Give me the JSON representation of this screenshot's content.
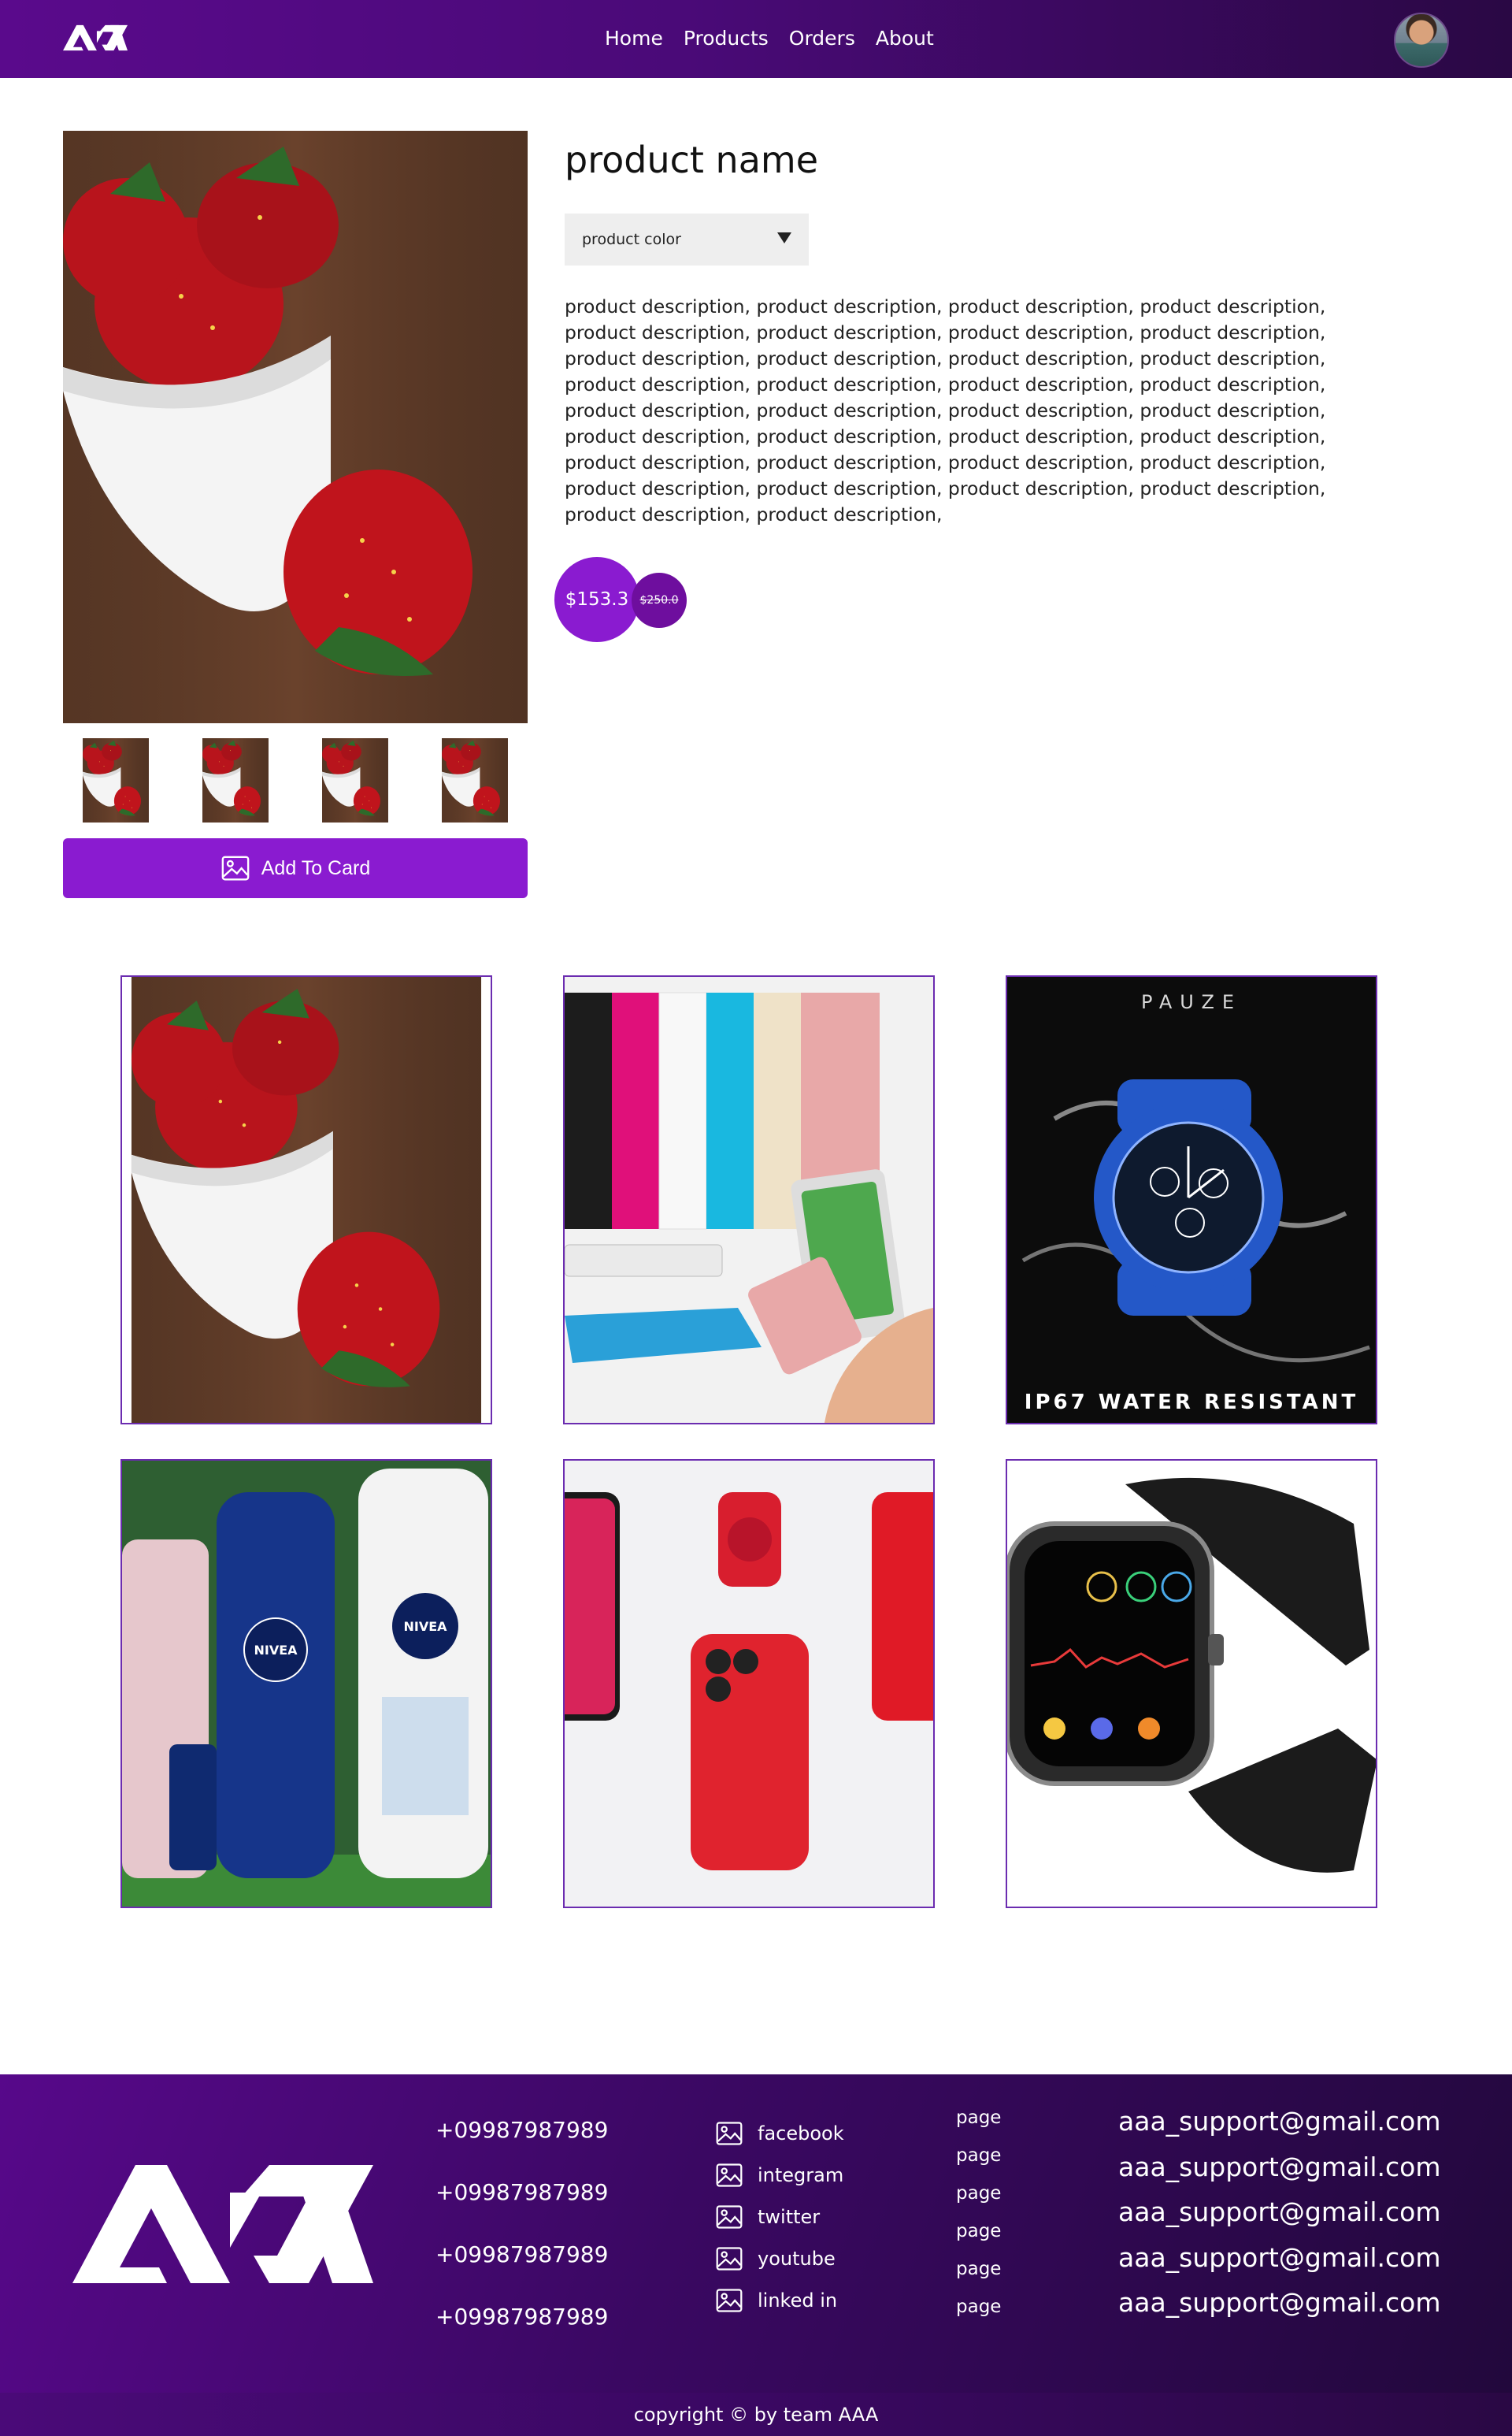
{
  "nav": {
    "links": [
      "Home",
      "Products",
      "Orders",
      "About"
    ]
  },
  "product": {
    "name": "product name",
    "color_select": {
      "value": "product color"
    },
    "description": "product description, product description, product description, product description, product description, product description, product description, product description, product description, product description, product description, product description, product description, product description, product description, product description, product description, product description, product description, product description, product description, product description, product description, product description, product description, product description, product description, product description, product description, product description, product description, product description, product description, product description,",
    "price": "$153.3",
    "old_price": "$250.0",
    "add_button_label": "Add To Card",
    "thumbnail_count": 4
  },
  "grid": {
    "items": [
      {
        "subject": "strawberries"
      },
      {
        "subject": "power banks"
      },
      {
        "subject": "sports watch",
        "brand_text": "PAUZE",
        "caption": "IP67 WATER RESISTANT"
      },
      {
        "subject": "lotions",
        "brand_text": "NIVEA"
      },
      {
        "subject": "phones and watch"
      },
      {
        "subject": "smart watch"
      }
    ]
  },
  "footer": {
    "phones": [
      "+09987987989",
      "+09987987989",
      "+09987987989",
      "+09987987989"
    ],
    "socials": [
      "facebook",
      "integram",
      "twitter",
      "youtube",
      "linked in"
    ],
    "pages": [
      "page",
      "page",
      "page",
      "page",
      "page",
      "page"
    ],
    "emails": [
      "aaa_support@gmail.com",
      "aaa_support@gmail.com",
      "aaa_support@gmail.com",
      "aaa_support@gmail.com",
      "aaa_support@gmail.com"
    ],
    "copyright": "copyright © by team AAA"
  },
  "colors": {
    "accent": "#8a1bd0",
    "nav_dark": "#2a0844",
    "footer_purple": "#57088a"
  }
}
